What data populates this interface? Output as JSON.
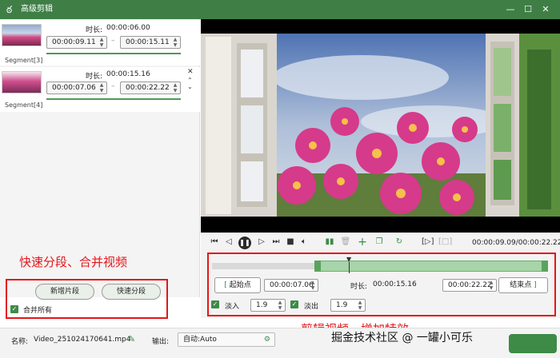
{
  "window": {
    "title": "高级剪辑",
    "min": "—",
    "max": "☐",
    "close": "✕"
  },
  "segments": [
    {
      "label": "Segment[3]",
      "duration_label": "时长:",
      "duration": "00:00:06.00",
      "start": "00:00:09.11",
      "end": "00:00:15.11",
      "dash": "–"
    },
    {
      "label": "Segment[4]",
      "duration_label": "时长:",
      "duration": "00:00:15.16",
      "start": "00:00:07.06",
      "end": "00:00:22.22",
      "dash": "–"
    }
  ],
  "left_bottom": {
    "annotation": "快速分段、合并视频",
    "add_segment": "新增片段",
    "quick_split": "快速分段",
    "merge_all": "合并所有"
  },
  "player": {
    "time": "00:00:09.09/00:00:22.22"
  },
  "edit": {
    "start_label": "起始点",
    "start_value": "00:00:07.06",
    "duration_label": "时长:",
    "duration_value": "00:00:15.16",
    "end_value": "00:00:22.22",
    "end_label": "结束点",
    "fade_in_label": "淡入",
    "fade_in_value": "1.9",
    "fade_out_label": "淡出",
    "fade_out_value": "1.9",
    "annotation": "剪辑视频、增加特效"
  },
  "footer": {
    "name_label": "名称:",
    "name_value": "Video_251024170641.mp4",
    "output_label": "输出:",
    "output_value": "自动:Auto",
    "watermark": "掘金技术社区 @ 一罐小可乐"
  },
  "colors": {
    "brand": "#3f7f46",
    "accent_green": "#4c9a57",
    "annotation_red": "#e3161a"
  }
}
